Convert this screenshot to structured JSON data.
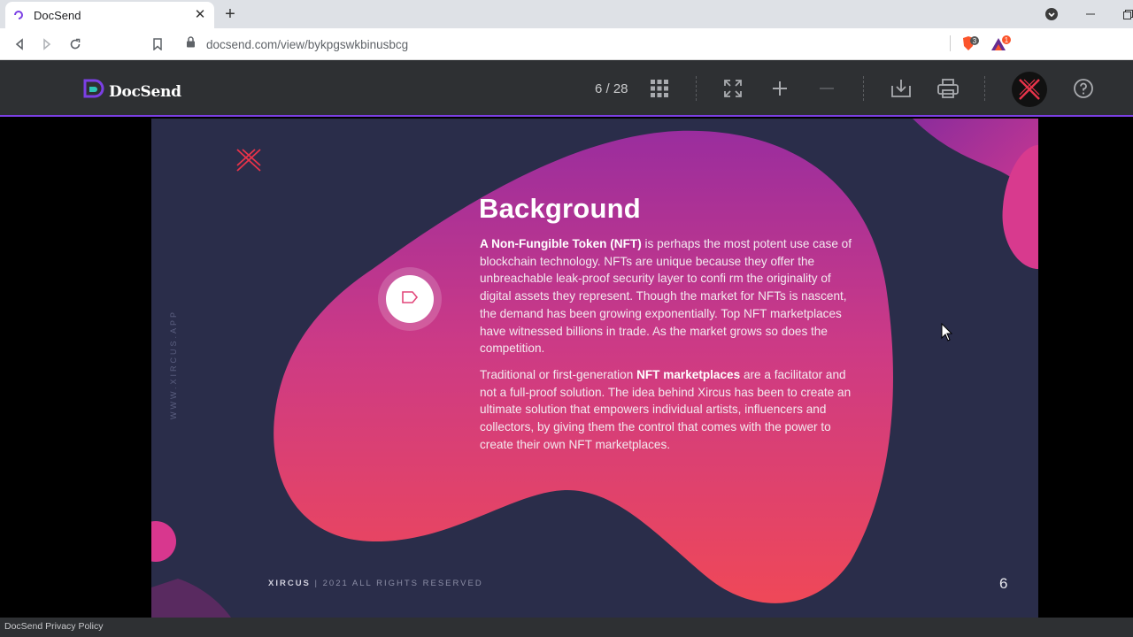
{
  "browser": {
    "tab_title": "DocSend",
    "url": "docsend.com/view/bykpgswkbinusbcg",
    "ext_badge_1": "3",
    "ext_badge_2": "1"
  },
  "docsend": {
    "logo_text": "DocSend",
    "page_counter": "6 / 28",
    "privacy_link": "DocSend Privacy Policy"
  },
  "slide": {
    "title": "Background",
    "p1_bold": "A Non-Fungible Token (NFT)",
    "p1_rest": " is perhaps the most potent use case of blockchain technology. NFTs are unique because they offer the unbreachable leak-proof security layer to confi rm the originality of digital assets they represent. Though the market for NFTs is nascent, the demand has been growing exponentially. Top NFT marketplaces have witnessed billions in trade. As the market grows so does the competition.",
    "p2_start": "Traditional or first-generation ",
    "p2_bold": "NFT marketplaces",
    "p2_rest": " are a facilitator and not a full-proof solution. The idea behind Xircus has been to create an ultimate solution that empowers individual artists, influencers and collectors, by giving them the control that comes with the power to create their own NFT marketplaces.",
    "side_text": "WWW.XIRCUS.APP",
    "footer_brand": "XIRCUS",
    "footer_rest": " | 2021 ALL RIGHTS RESERVED",
    "page_number": "6"
  },
  "colors": {
    "accent": "#7b3fe4",
    "blob_top": "#a02fa0",
    "blob_bottom": "#ee4a5a",
    "slide_bg": "#2a2d4a"
  }
}
